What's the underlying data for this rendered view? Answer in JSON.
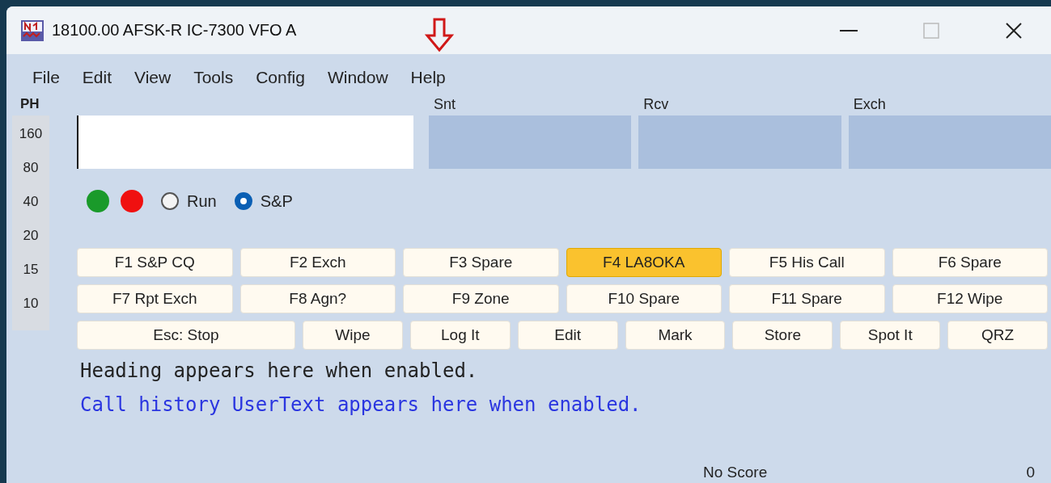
{
  "window": {
    "title": "18100.00 AFSK-R IC-7300 VFO A"
  },
  "menu": [
    "File",
    "Edit",
    "View",
    "Tools",
    "Config",
    "Window",
    "Help"
  ],
  "band_panel": {
    "mode": "PH",
    "bands": [
      "160",
      "80",
      "40",
      "20",
      "15",
      "10"
    ]
  },
  "exchange_fields": [
    {
      "label": "Snt"
    },
    {
      "label": "Rcv"
    },
    {
      "label": "Exch"
    }
  ],
  "indicators": [
    {
      "color": "#1a9a2a"
    },
    {
      "color": "#f01010"
    }
  ],
  "modes": [
    {
      "label": "Run",
      "selected": false
    },
    {
      "label": "S&P",
      "selected": true
    }
  ],
  "key_rows": [
    [
      {
        "label": "F1 S&P CQ",
        "highlighted": false
      },
      {
        "label": "F2 Exch",
        "highlighted": false
      },
      {
        "label": "F3 Spare",
        "highlighted": false
      },
      {
        "label": "F4 LA8OKA",
        "highlighted": true
      },
      {
        "label": "F5 His Call",
        "highlighted": false
      },
      {
        "label": "F6 Spare",
        "highlighted": false
      }
    ],
    [
      {
        "label": "F7 Rpt Exch",
        "highlighted": false
      },
      {
        "label": "F8 Agn?",
        "highlighted": false
      },
      {
        "label": "F9 Zone",
        "highlighted": false
      },
      {
        "label": "F10 Spare",
        "highlighted": false
      },
      {
        "label": "F11 Spare",
        "highlighted": false
      },
      {
        "label": "F12 Wipe",
        "highlighted": false
      }
    ],
    [
      {
        "label": "Esc: Stop",
        "highlighted": false,
        "wide": true
      },
      {
        "label": "Wipe",
        "highlighted": false
      },
      {
        "label": "Log It",
        "highlighted": false
      },
      {
        "label": "Edit",
        "highlighted": false
      },
      {
        "label": "Mark",
        "highlighted": false
      },
      {
        "label": "Store",
        "highlighted": false
      },
      {
        "label": "Spot It",
        "highlighted": false
      },
      {
        "label": "QRZ",
        "highlighted": false
      }
    ]
  ],
  "heading_text": "Heading appears here when enabled.",
  "user_text": "Call history UserText appears here when enabled.",
  "status_bar": {
    "score": "No Score",
    "count": "0"
  }
}
